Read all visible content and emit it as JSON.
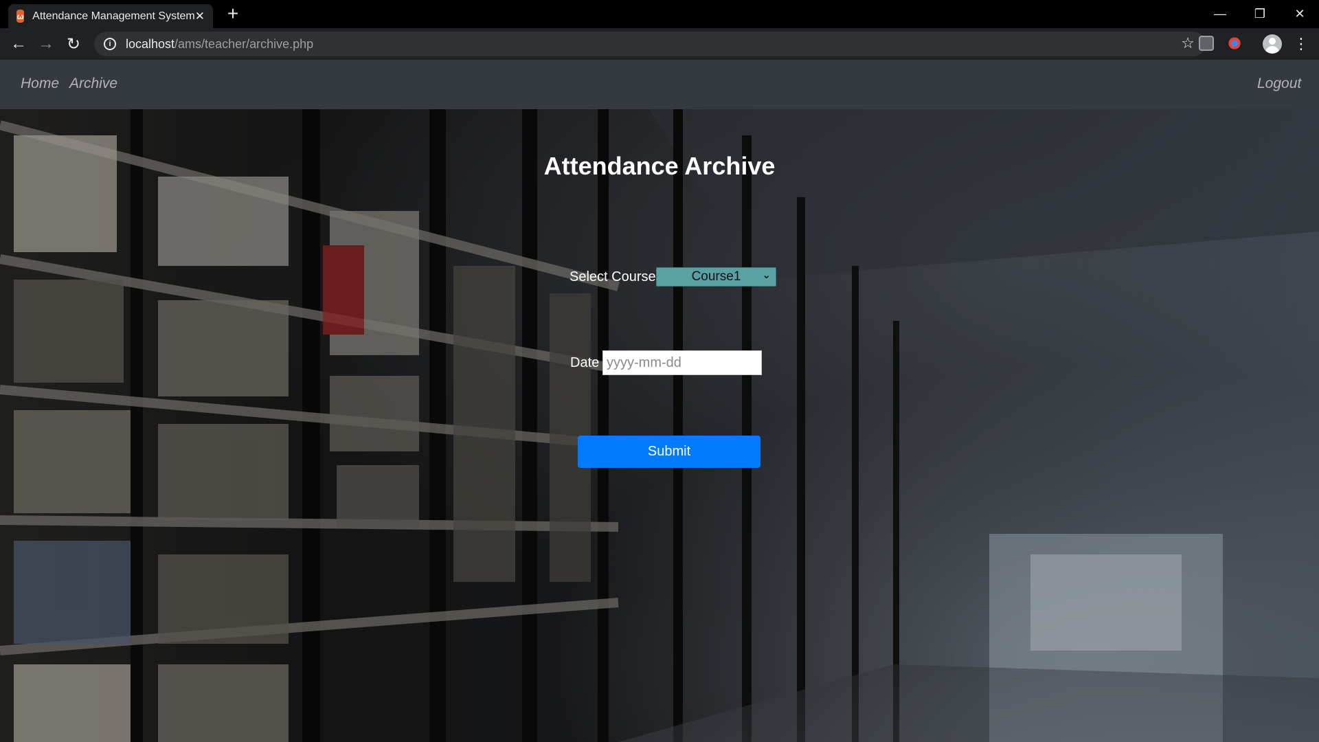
{
  "browser": {
    "tab_title": "Attendance Management System",
    "tab_close_glyph": "✕",
    "new_tab_glyph": "+",
    "url_host": "localhost",
    "url_path": "/ams/teacher/archive.php",
    "back_glyph": "←",
    "forward_glyph": "→",
    "reload_glyph": "↻",
    "info_glyph": "i",
    "star_glyph": "☆",
    "menu_glyph": "⋮",
    "minimize_glyph": "—",
    "restore_glyph": "❐",
    "close_glyph": "✕",
    "favicon_text": "ω"
  },
  "navbar": {
    "home": "Home",
    "archive": "Archive",
    "logout": "Logout"
  },
  "main": {
    "title": "Attendance Archive",
    "course_label": "Select Course",
    "course_selected": "Course1",
    "course_chevron": "⌄",
    "date_label": "Date",
    "date_placeholder": "yyyy-mm-dd",
    "submit_label": "Submit"
  },
  "colors": {
    "navbar_bg": "#343a40",
    "submit_bg": "#007bff",
    "select_bg": "#5aa1a4",
    "favicon_bg": "#e8602c"
  }
}
